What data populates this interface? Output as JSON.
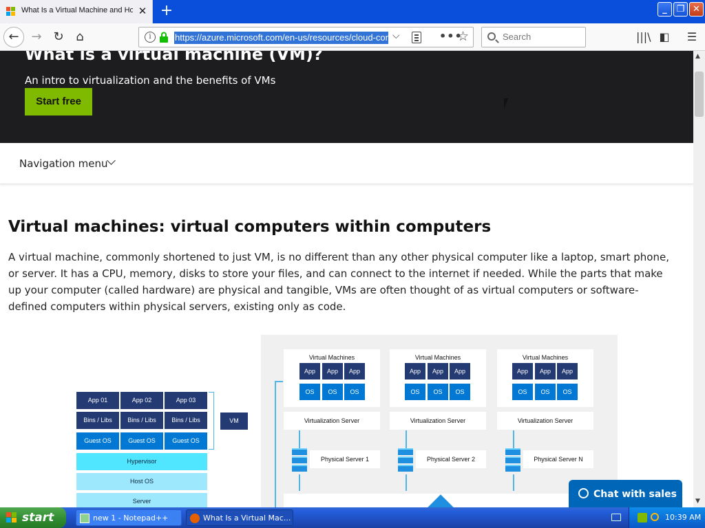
{
  "browser": {
    "tab_title": "What Is a Virtual Machine and How Does It Work | Microsoft Azure",
    "url": "https://azure.microsoft.com/en-us/resources/cloud-computing-dictionary/what-is-a-virtual-machine/",
    "search_placeholder": "Search"
  },
  "hero": {
    "title": "What is a virtual machine (VM)?",
    "subtitle": "An intro to virtualization and the benefits of VMs",
    "cta": "Start free"
  },
  "nav_menu": {
    "label": "Navigation menu"
  },
  "article": {
    "heading": "Virtual machines: virtual computers within computers",
    "paragraph": "A virtual machine, commonly shortened to just VM, is no different than any other physical computer like a laptop, smart phone, or server. It has a CPU, memory, disks to store your files, and can connect to the internet if needed. While the parts that make up your computer (called hardware) are physical and tangible, VMs are often thought of as virtual computers or software-defined computers within physical servers, existing only as code."
  },
  "diagram": {
    "left": {
      "apps": [
        "App 01",
        "App 02",
        "App 03"
      ],
      "bins": [
        "Bins / Libs",
        "Bins / Libs",
        "Bins / Libs"
      ],
      "guests": [
        "Guest OS",
        "Guest OS",
        "Guest OS"
      ],
      "hypervisor": "Hypervisor",
      "host_os": "Host OS",
      "server": "Server",
      "vm_label": "VM"
    },
    "columns": [
      {
        "title": "Virtual Machines",
        "app": "App",
        "os": "OS",
        "virt": "Virtualization Server",
        "phys": "Physical Server 1"
      },
      {
        "title": "Virtual Machines",
        "app": "App",
        "os": "OS",
        "virt": "Virtualization Server",
        "phys": "Physical Server 2"
      },
      {
        "title": "Virtual Machines",
        "app": "App",
        "os": "OS",
        "virt": "Virtualization Server",
        "phys": "Physical Server N"
      }
    ]
  },
  "chat": {
    "label": "Chat with sales"
  },
  "taskbar": {
    "start": "start",
    "items": [
      "new 1 - Notepad++",
      "What Is a Virtual Mac..."
    ],
    "clock": "10:39 AM"
  }
}
